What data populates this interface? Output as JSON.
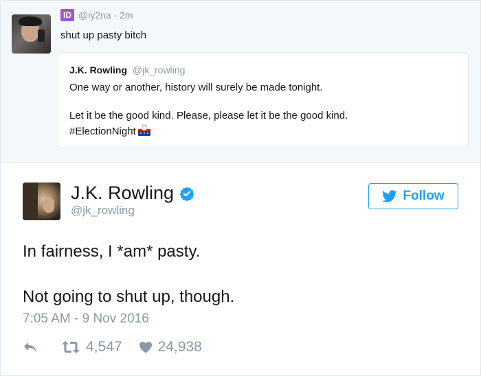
{
  "colors": {
    "twitter_blue": "#1da1f2",
    "muted_text": "#8899a6",
    "main_text": "#14171a",
    "border": "#e1e8ed",
    "id_logo": "#9b59d0"
  },
  "reply": {
    "logo_text": "ID",
    "handle_time": "@iy2na · 2m",
    "text": "shut up pasty bitch",
    "quoted": {
      "name": "J.K. Rowling",
      "handle": "@jk_rowling",
      "line1": "One way or another, history will surely be made tonight.",
      "line2": "Let it be the good kind. Please, please let it be the good kind.",
      "line3": "#ElectionNight"
    }
  },
  "tweet": {
    "name": "J.K. Rowling",
    "handle": "@jk_rowling",
    "follow_label": "Follow",
    "line1": "In fairness, I *am* pasty.",
    "line2": "Not going to shut up, though.",
    "timestamp": "7:05 AM - 9 Nov 2016",
    "retweets": "4,547",
    "likes": "24,938"
  },
  "icons": [
    "id-logo-icon",
    "ballot-box-icon",
    "verified-icon",
    "twitter-bird-icon",
    "reply-icon",
    "retweet-icon",
    "heart-icon"
  ]
}
